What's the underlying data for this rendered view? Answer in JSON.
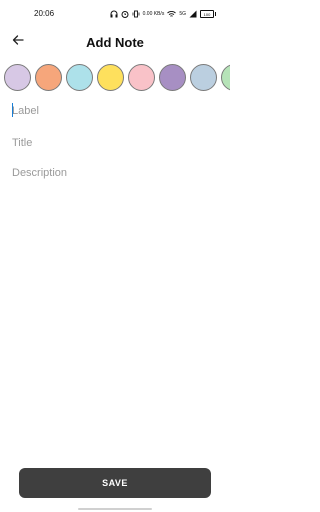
{
  "status_bar": {
    "time": "20:06",
    "network_speed": "0.00 KB/s",
    "signal_text": "5G",
    "battery": "100"
  },
  "header": {
    "title": "Add Note"
  },
  "colors": [
    {
      "name": "lavender",
      "hex": "#d7c8e5"
    },
    {
      "name": "orange",
      "hex": "#f6a67b"
    },
    {
      "name": "light-blue",
      "hex": "#ade1ea"
    },
    {
      "name": "yellow",
      "hex": "#fee05d"
    },
    {
      "name": "pink",
      "hex": "#f9c2c8"
    },
    {
      "name": "purple",
      "hex": "#a78fc3"
    },
    {
      "name": "blue-grey",
      "hex": "#bbcfe0"
    },
    {
      "name": "green",
      "hex": "#b6e3b8"
    }
  ],
  "form": {
    "label_placeholder": "Label",
    "title_placeholder": "Title",
    "description_placeholder": "Description"
  },
  "actions": {
    "save_label": "SAVE"
  }
}
